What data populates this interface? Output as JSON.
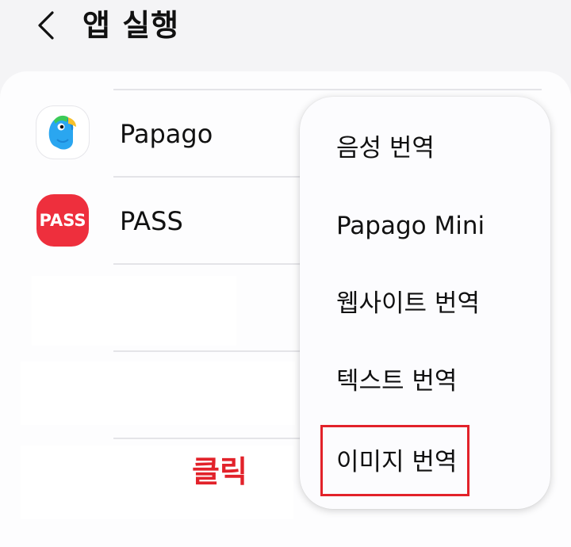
{
  "header": {
    "back_icon": "chevron-left-icon",
    "title": "앱 실행"
  },
  "apps": [
    {
      "label": "Papago",
      "icon": "papago-parrot-icon"
    },
    {
      "label": "PASS",
      "icon_text": "PASS",
      "icon_color": "#ee2f3d"
    }
  ],
  "annotation": {
    "text": "클릭",
    "color": "#e2222a"
  },
  "menu": {
    "items": [
      {
        "label": "음성 번역"
      },
      {
        "label": "Papago Mini"
      },
      {
        "label": "웹사이트 번역"
      },
      {
        "label": "텍스트 번역"
      },
      {
        "label": "이미지 번역"
      }
    ]
  }
}
